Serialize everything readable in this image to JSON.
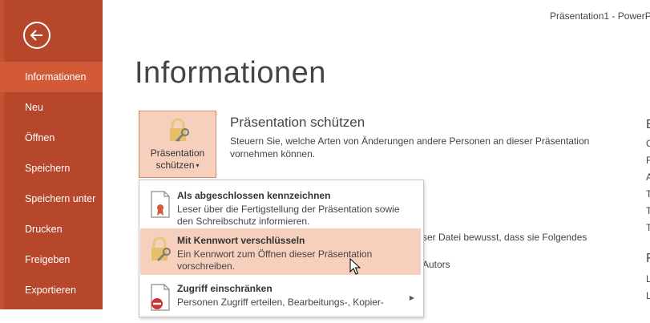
{
  "window": {
    "title": "Präsentation1 - PowerPo"
  },
  "sidebar": {
    "items": [
      {
        "label": "Informationen"
      },
      {
        "label": "Neu"
      },
      {
        "label": "Öffnen"
      },
      {
        "label": "Speichern"
      },
      {
        "label": "Speichern unter"
      },
      {
        "label": "Drucken"
      },
      {
        "label": "Freigeben"
      },
      {
        "label": "Exportieren"
      }
    ]
  },
  "main": {
    "title": "Informationen",
    "protect": {
      "button_line1": "Präsentation",
      "button_line2": "schützen",
      "heading": "Präsentation schützen",
      "description": "Steuern Sie, welche Arten von Änderungen andere Personen an dieser Präsentation vornehmen können."
    },
    "background_text": {
      "line1": "ser Datei bewusst, dass sie Folgendes",
      "line2": "Autors"
    },
    "right_column": [
      "E",
      "C",
      "F",
      "A",
      "T",
      "T",
      "T",
      "F",
      "L",
      "L"
    ]
  },
  "menu": {
    "items": [
      {
        "title": "Als abgeschlossen kennzeichnen",
        "description": "Leser über die Fertigstellung der Präsentation sowie den Schreibschutz informieren."
      },
      {
        "title": "Mit Kennwort verschlüsseln",
        "description": "Ein Kennwort zum Öffnen dieser Präsentation vorschreiben."
      },
      {
        "title": "Zugriff einschränken",
        "description": "Personen Zugriff erteilen, Bearbeitungs-, Kopier-"
      }
    ]
  },
  "colors": {
    "sidebar_bg": "#b7472a",
    "sidebar_active": "#d35a37",
    "highlight": "#f6cfbd"
  }
}
